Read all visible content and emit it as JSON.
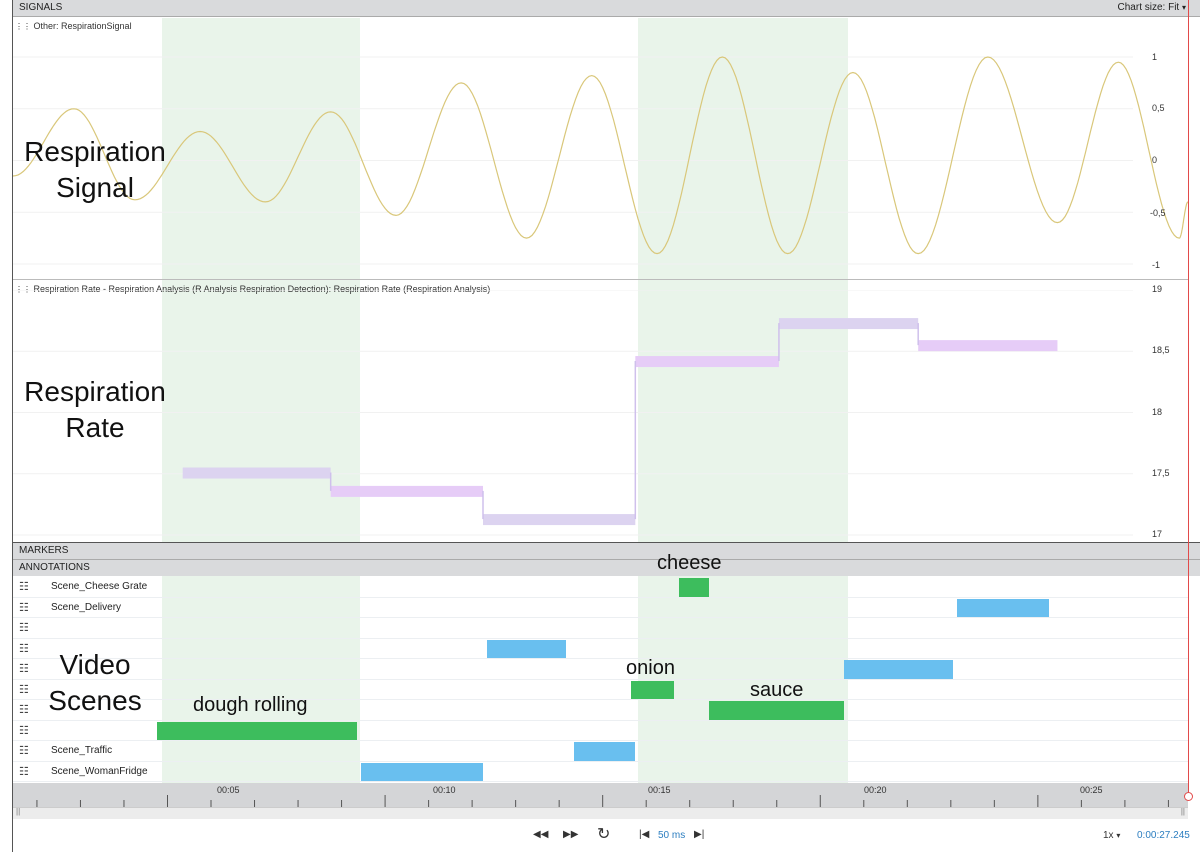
{
  "signals_header": {
    "title": "SIGNALS",
    "chart_size_label": "Chart size:",
    "chart_size_value": "Fit"
  },
  "resp_signal": {
    "panel_title": "Other: RespirationSignal",
    "overlay_label": [
      "Respiration",
      "Signal"
    ],
    "y_ticks": [
      "1",
      "0,5",
      "0",
      "-0,5",
      "-1"
    ],
    "y_values": [
      1,
      0.5,
      0,
      -0.5,
      -1
    ],
    "color": "#d9c77a"
  },
  "resp_rate": {
    "panel_title": "Respiration Rate - Respiration Analysis (R Analysis Respiration Detection): Respiration Rate (Respiration Analysis)",
    "overlay_label": [
      "Respiration",
      "Rate"
    ],
    "y_ticks": [
      "19",
      "18,5",
      "18",
      "17,5",
      "17"
    ],
    "y_values": [
      19,
      18.5,
      18,
      17.5,
      17
    ],
    "color": "#e3c8f6"
  },
  "markers_header": "MARKERS",
  "annotations_header": "ANNOTATIONS",
  "scene_rows": [
    {
      "label": "Scene_Cheese Grate"
    },
    {
      "label": "Scene_Delivery"
    },
    {
      "label": ""
    },
    {
      "label": ""
    },
    {
      "label": ""
    },
    {
      "label": ""
    },
    {
      "label": ""
    },
    {
      "label": ""
    },
    {
      "label": "Scene_Traffic"
    },
    {
      "label": "Scene_WomanFridge"
    }
  ],
  "scene_overlay_label": [
    "Video",
    "Scenes"
  ],
  "scene_annotations": {
    "cheese": "cheese",
    "onion": "onion",
    "sauce": "sauce",
    "dough": "dough rolling"
  },
  "timeline": {
    "labels": [
      "00:05",
      "00:10",
      "00:15",
      "00:20",
      "00:25"
    ]
  },
  "controls": {
    "step": "50 ms",
    "speed": "1x",
    "time": "0:00:27.245"
  },
  "chart_data": [
    {
      "type": "line",
      "title": "Other: RespirationSignal",
      "xlim": [
        1.6,
        28.6
      ],
      "ylim": [
        -1,
        1
      ],
      "x_ticks": [
        "00:05",
        "00:10",
        "00:15",
        "00:20",
        "00:25"
      ],
      "peaks": [
        [
          1.6,
          -0.15
        ],
        [
          3.0,
          0.5
        ],
        [
          4.4,
          -0.38
        ],
        [
          5.9,
          0.28
        ],
        [
          7.4,
          -0.4
        ],
        [
          8.9,
          0.47
        ],
        [
          10.4,
          -0.53
        ],
        [
          11.9,
          0.75
        ],
        [
          13.4,
          -0.75
        ],
        [
          14.9,
          0.82
        ],
        [
          16.4,
          -0.9
        ],
        [
          17.9,
          1.0
        ],
        [
          19.4,
          -0.9
        ],
        [
          20.9,
          0.85
        ],
        [
          22.4,
          -0.9
        ],
        [
          24.0,
          1.0
        ],
        [
          25.6,
          -0.6
        ],
        [
          27.0,
          0.95
        ],
        [
          28.4,
          -0.75
        ],
        [
          28.6,
          -0.4
        ]
      ],
      "shaded_ranges": [
        [
          4.9,
          9.5
        ],
        [
          15.9,
          20.7
        ]
      ]
    },
    {
      "type": "line",
      "title": "Respiration Rate",
      "xlim": [
        1.6,
        28.6
      ],
      "ylim": [
        17,
        19
      ],
      "steps": [
        {
          "x0": 5.5,
          "x1": 8.9,
          "value": 17.51
        },
        {
          "x0": 8.9,
          "x1": 12.4,
          "value": 17.36
        },
        {
          "x0": 12.4,
          "x1": 15.9,
          "value": 17.13
        },
        {
          "x0": 15.9,
          "x1": 19.2,
          "value": 18.42
        },
        {
          "x0": 19.2,
          "x1": 22.4,
          "value": 18.73
        },
        {
          "x0": 22.4,
          "x1": 25.6,
          "value": 18.55
        }
      ]
    }
  ],
  "scene_blocks": [
    {
      "row": 0,
      "x0": 16.9,
      "x1": 17.6,
      "color": "#3dbd5d"
    },
    {
      "row": 1,
      "x0": 23.3,
      "x1": 25.4,
      "color": "#69bfef"
    },
    {
      "row": 3,
      "x0": 12.5,
      "x1": 14.3,
      "color": "#69bfef"
    },
    {
      "row": 4,
      "x0": 20.7,
      "x1": 23.2,
      "color": "#69bfef"
    },
    {
      "row": 5,
      "x0": 15.8,
      "x1": 16.8,
      "color": "#3dbd5d"
    },
    {
      "row": 6,
      "x0": 17.6,
      "x1": 20.7,
      "color": "#3dbd5d"
    },
    {
      "row": 7,
      "x0": 4.9,
      "x1": 9.5,
      "color": "#3dbd5d"
    },
    {
      "row": 8,
      "x0": 14.5,
      "x1": 15.9,
      "color": "#69bfef"
    },
    {
      "row": 9,
      "x0": 9.6,
      "x1": 12.4,
      "color": "#69bfef"
    }
  ]
}
